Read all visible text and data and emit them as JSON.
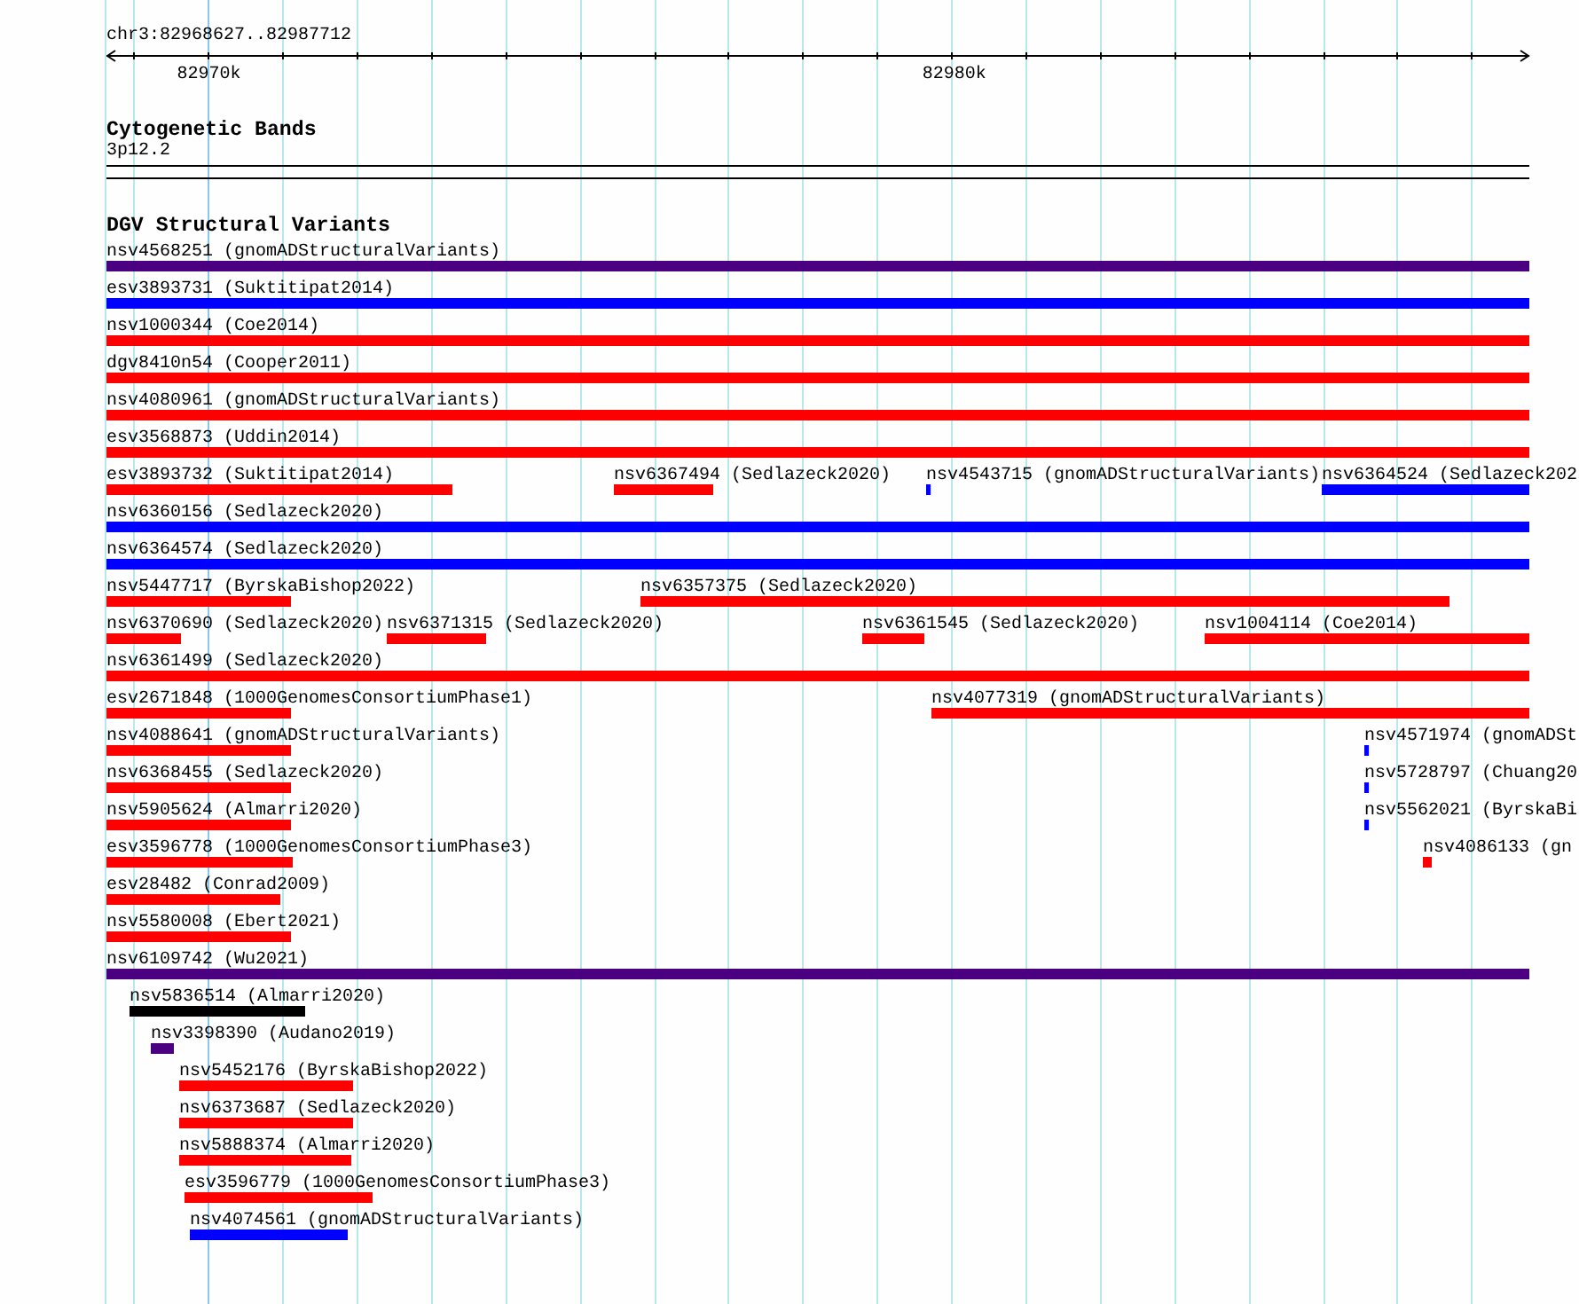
{
  "ruler": {
    "location": "chr3:82968627..82987712",
    "tick_labels": [
      "82970k",
      "82980k"
    ]
  },
  "cytogenetic_bands": {
    "title": "Cytogenetic Bands",
    "band": "3p12.2"
  },
  "dgv_structural_variants": {
    "title": "DGV Structural Variants",
    "rows": [
      {
        "features": [
          {
            "name": "nsv4568251 (gnomADStructuralVariants)",
            "color": "#4b0082"
          }
        ]
      },
      {
        "features": [
          {
            "name": "esv3893731 (Suktitipat2014)",
            "color": "#0000ff"
          }
        ]
      },
      {
        "features": [
          {
            "name": "nsv1000344 (Coe2014)",
            "color": "#ff0000"
          }
        ]
      },
      {
        "features": [
          {
            "name": "dgv8410n54 (Cooper2011)",
            "color": "#ff0000"
          }
        ]
      },
      {
        "features": [
          {
            "name": "nsv4080961 (gnomADStructuralVariants)",
            "color": "#ff0000"
          }
        ]
      },
      {
        "features": [
          {
            "name": "esv3568873 (Uddin2014)",
            "color": "#ff0000"
          }
        ]
      },
      {
        "features": [
          {
            "name": "esv3893732 (Suktitipat2014)",
            "color": "#ff0000"
          },
          {
            "name": "nsv6367494 (Sedlazeck2020)",
            "color": "#ff0000"
          },
          {
            "name": "nsv4543715 (gnomADStructuralVariants)",
            "color": "#0000ff"
          },
          {
            "name": "nsv6364524 (Sedlazeck202",
            "color": "#0000ff"
          }
        ]
      },
      {
        "features": [
          {
            "name": "nsv6360156 (Sedlazeck2020)",
            "color": "#0000ff"
          }
        ]
      },
      {
        "features": [
          {
            "name": "nsv6364574 (Sedlazeck2020)",
            "color": "#0000ff"
          }
        ]
      },
      {
        "features": [
          {
            "name": "nsv5447717 (ByrskaBishop2022)",
            "color": "#ff0000"
          },
          {
            "name": "nsv6357375 (Sedlazeck2020)",
            "color": "#ff0000"
          }
        ]
      },
      {
        "features": [
          {
            "name": "nsv6370690 (Sedlazeck2020)",
            "color": "#ff0000"
          },
          {
            "name": "nsv6371315 (Sedlazeck2020)",
            "color": "#ff0000"
          },
          {
            "name": "nsv6361545 (Sedlazeck2020)",
            "color": "#ff0000"
          },
          {
            "name": "nsv1004114 (Coe2014)",
            "color": "#ff0000"
          }
        ]
      },
      {
        "features": [
          {
            "name": "nsv6361499 (Sedlazeck2020)",
            "color": "#ff0000"
          }
        ]
      },
      {
        "features": [
          {
            "name": "esv2671848 (1000GenomesConsortiumPhase1)",
            "color": "#ff0000"
          },
          {
            "name": "nsv4077319 (gnomADStructuralVariants)",
            "color": "#ff0000"
          }
        ]
      },
      {
        "features": [
          {
            "name": "nsv4088641 (gnomADStructuralVariants)",
            "color": "#ff0000"
          },
          {
            "name": "nsv4571974 (gnomADSt",
            "color": "#0000ff"
          }
        ]
      },
      {
        "features": [
          {
            "name": "nsv6368455 (Sedlazeck2020)",
            "color": "#ff0000"
          },
          {
            "name": "nsv5728797 (Chuang20",
            "color": "#0000ff"
          }
        ]
      },
      {
        "features": [
          {
            "name": "nsv5905624 (Almarri2020)",
            "color": "#ff0000"
          },
          {
            "name": "nsv5562021 (ByrskaBi",
            "color": "#0000ff"
          }
        ]
      },
      {
        "features": [
          {
            "name": "esv3596778 (1000GenomesConsortiumPhase3)",
            "color": "#ff0000"
          },
          {
            "name": "nsv4086133 (gn",
            "color": "#ff0000"
          }
        ]
      },
      {
        "features": [
          {
            "name": "esv28482 (Conrad2009)",
            "color": "#ff0000"
          }
        ]
      },
      {
        "features": [
          {
            "name": "nsv5580008 (Ebert2021)",
            "color": "#ff0000"
          }
        ]
      },
      {
        "features": [
          {
            "name": "nsv6109742 (Wu2021)",
            "color": "#4b0082"
          }
        ]
      },
      {
        "features": [
          {
            "name": "nsv5836514 (Almarri2020)",
            "color": "#000000"
          }
        ]
      },
      {
        "features": [
          {
            "name": "nsv3398390 (Audano2019)",
            "color": "#4b0082"
          }
        ]
      },
      {
        "features": [
          {
            "name": "nsv5452176 (ByrskaBishop2022)",
            "color": "#ff0000"
          }
        ]
      },
      {
        "features": [
          {
            "name": "nsv6373687 (Sedlazeck2020)",
            "color": "#ff0000"
          }
        ]
      },
      {
        "features": [
          {
            "name": "nsv5888374 (Almarri2020)",
            "color": "#ff0000"
          }
        ]
      },
      {
        "features": [
          {
            "name": "esv3596779 (1000GenomesConsortiumPhase3)",
            "color": "#ff0000"
          }
        ]
      },
      {
        "features": [
          {
            "name": "nsv4074561 (gnomADStructuralVariants)",
            "color": "#0000ff"
          }
        ]
      }
    ]
  }
}
